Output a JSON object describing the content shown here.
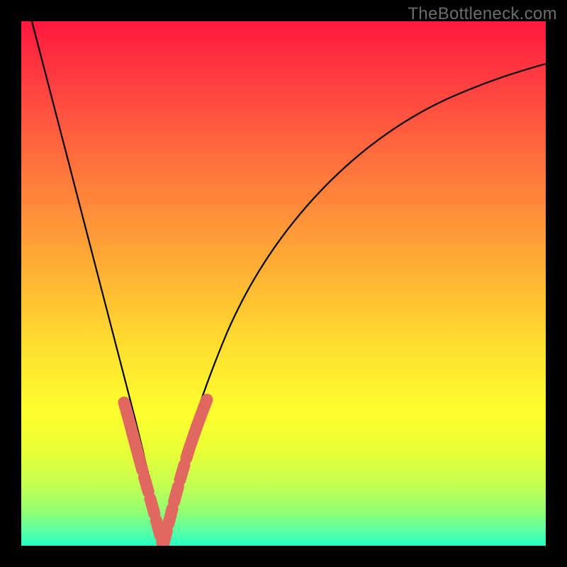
{
  "watermark": "TheBottleneck.com",
  "colors": {
    "background": "#000000",
    "watermark_text": "#6d6d6d",
    "curve_stroke": "#000000",
    "bead_stroke": "#e0685f",
    "gradient_top": "#ff183f",
    "gradient_bottom": "#26ffc4"
  },
  "chart_data": {
    "type": "line",
    "title": "",
    "xlabel": "",
    "ylabel": "",
    "xlim": [
      0,
      100
    ],
    "ylim": [
      0,
      100
    ],
    "grid": false,
    "legend": false,
    "series": [
      {
        "name": "left_curve",
        "x": [
          2,
          5,
          8,
          11,
          14,
          17,
          20,
          22,
          24,
          25.5,
          27
        ],
        "y": [
          100,
          86,
          72,
          58,
          45,
          33,
          22,
          13,
          6,
          2,
          0
        ]
      },
      {
        "name": "right_curve",
        "x": [
          27,
          28.5,
          31,
          34,
          38,
          43,
          50,
          58,
          67,
          77,
          88,
          100
        ],
        "y": [
          0,
          2,
          8,
          17,
          28,
          40,
          53,
          65,
          74,
          82,
          87,
          92
        ]
      }
    ],
    "annotations": [
      {
        "name": "bead_overlay",
        "description": "rounded dashed salmon-colored overlay along the lower portion of the V-curve near its minimum",
        "approx_x_range": [
          19,
          35
        ],
        "approx_y_range": [
          0,
          28
        ]
      }
    ],
    "notes": "Plot background is a vertical rainbow gradient from red (top, y=100) through orange/yellow to green (bottom, y=0). A black V-shaped curve descends steeply from top-left to a minimum near x≈27, then rises with decreasing slope toward the upper-right. No axes, ticks, legend, or numeric labels are drawn. Values estimated from pixel positions."
  }
}
